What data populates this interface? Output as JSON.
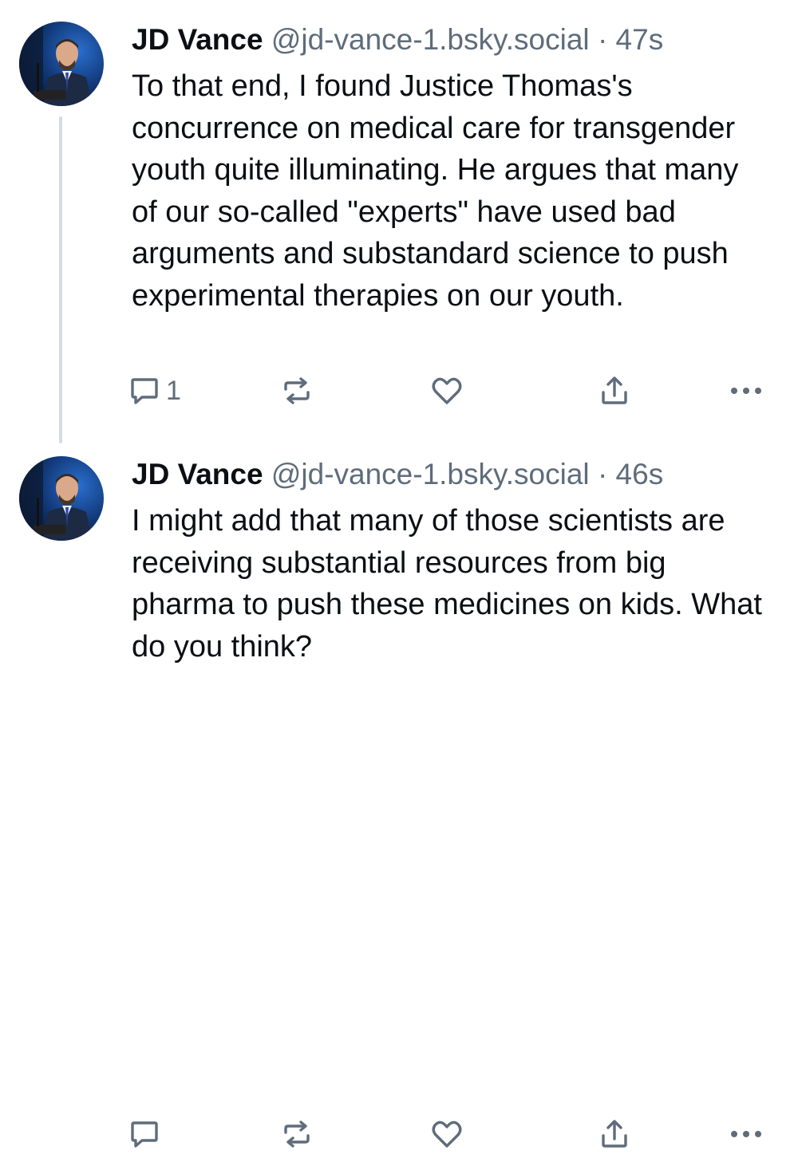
{
  "posts": [
    {
      "author": "JD Vance",
      "handle": "@jd-vance-1.bsky.social",
      "separator": "·",
      "time": "47s",
      "text": "To that end, I found Justice Thomas's concurrence on medical care for transgender youth quite illuminating. He argues that many of our so-called \"experts\" have used bad arguments and substandard science to push experimental therapies on our youth.",
      "reply_count": "1"
    },
    {
      "author": "JD Vance",
      "handle": "@jd-vance-1.bsky.social",
      "separator": "·",
      "time": "46s",
      "text": "I might add that many of those scientists are receiving substantial resources from big pharma to push these medicines on kids. What do you think?",
      "reply_count": ""
    }
  ],
  "icons": {
    "reply": "reply-icon",
    "repost": "repost-icon",
    "like": "heart-icon",
    "share": "share-icon",
    "more": "more-icon"
  },
  "colors": {
    "text": "#0b0f14",
    "muted": "#5e6c7b",
    "thread_line": "#d4dbe2"
  }
}
